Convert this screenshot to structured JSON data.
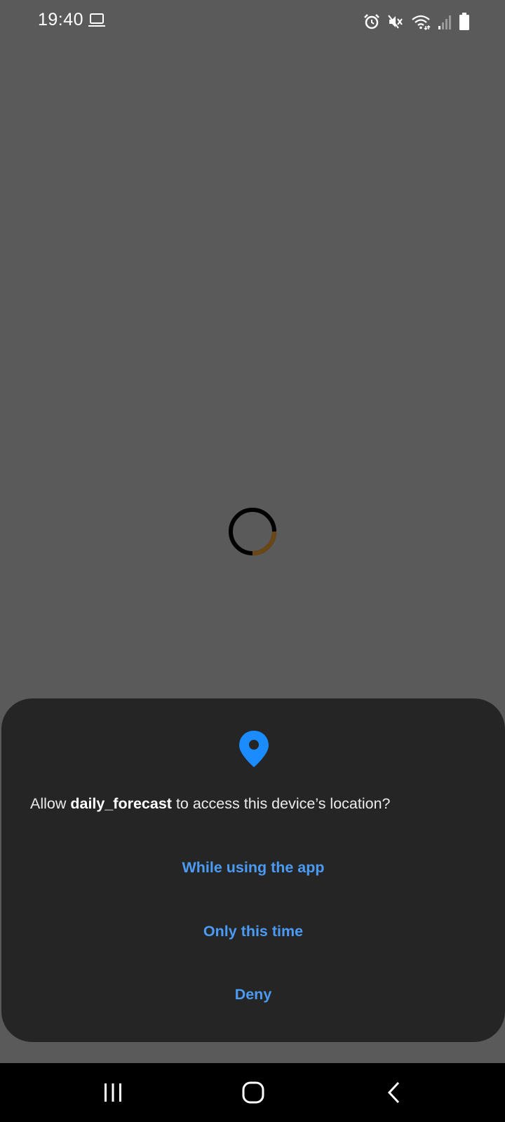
{
  "status_bar": {
    "time": "19:40",
    "left_icons": [
      "laptop-icon"
    ],
    "right_icons": [
      "alarm-icon",
      "mute-icon",
      "wifi-icon",
      "signal-icon",
      "battery-icon"
    ]
  },
  "loading_indicator": {
    "type": "spinner",
    "colors": {
      "track": "#000000",
      "arc": "#6b4714"
    }
  },
  "permission_dialog": {
    "icon": "location-pin-icon",
    "icon_color": "#1a8cff",
    "message_prefix": "Allow ",
    "app_name": "daily_forecast",
    "message_suffix": " to access this device’s location?",
    "buttons": [
      {
        "label": "While using the app"
      },
      {
        "label": "Only this time"
      },
      {
        "label": "Deny"
      }
    ],
    "button_color": "#4b9bf5",
    "background_color": "#252525"
  },
  "navigation_bar": {
    "buttons": [
      "recents-icon",
      "home-icon",
      "back-icon"
    ]
  }
}
